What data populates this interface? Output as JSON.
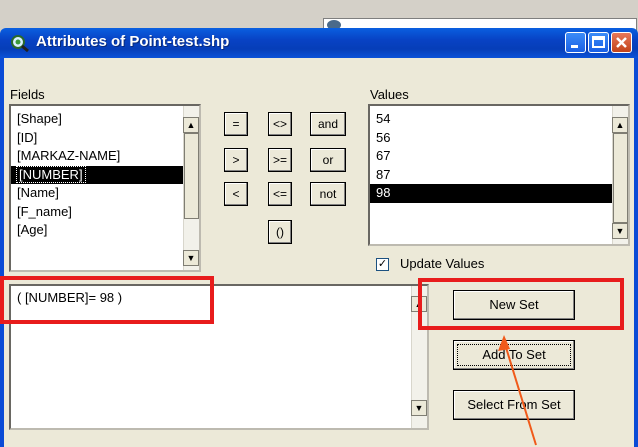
{
  "window": {
    "title": "Attributes of Point-test.shp"
  },
  "fields": {
    "label": "Fields",
    "items": [
      "[Shape]",
      "[ID]",
      "[MARKAZ-NAME]",
      "[NUMBER]",
      "[Name]",
      "[F_name]",
      "[Age]"
    ],
    "selected": "[NUMBER]"
  },
  "operators": {
    "row1": [
      "=",
      "<>",
      "and"
    ],
    "row2": [
      ">",
      ">=",
      "or"
    ],
    "row3": [
      "<",
      "<=",
      "not"
    ],
    "paren": "()"
  },
  "values": {
    "label": "Values",
    "items": [
      "54",
      "56",
      "67",
      "87",
      "98"
    ],
    "selected": "98"
  },
  "update_values": {
    "label": "Update Values",
    "checked": true
  },
  "query": {
    "text": "( [NUMBER]= 98 )"
  },
  "buttons": {
    "new_set": "New Set",
    "add_to_set": "Add To Set",
    "select_from_set": "Select From Set"
  },
  "colors": {
    "highlight": "#e81c1c",
    "arrow": "#f05a1a",
    "titlebar": "#0842c4"
  }
}
